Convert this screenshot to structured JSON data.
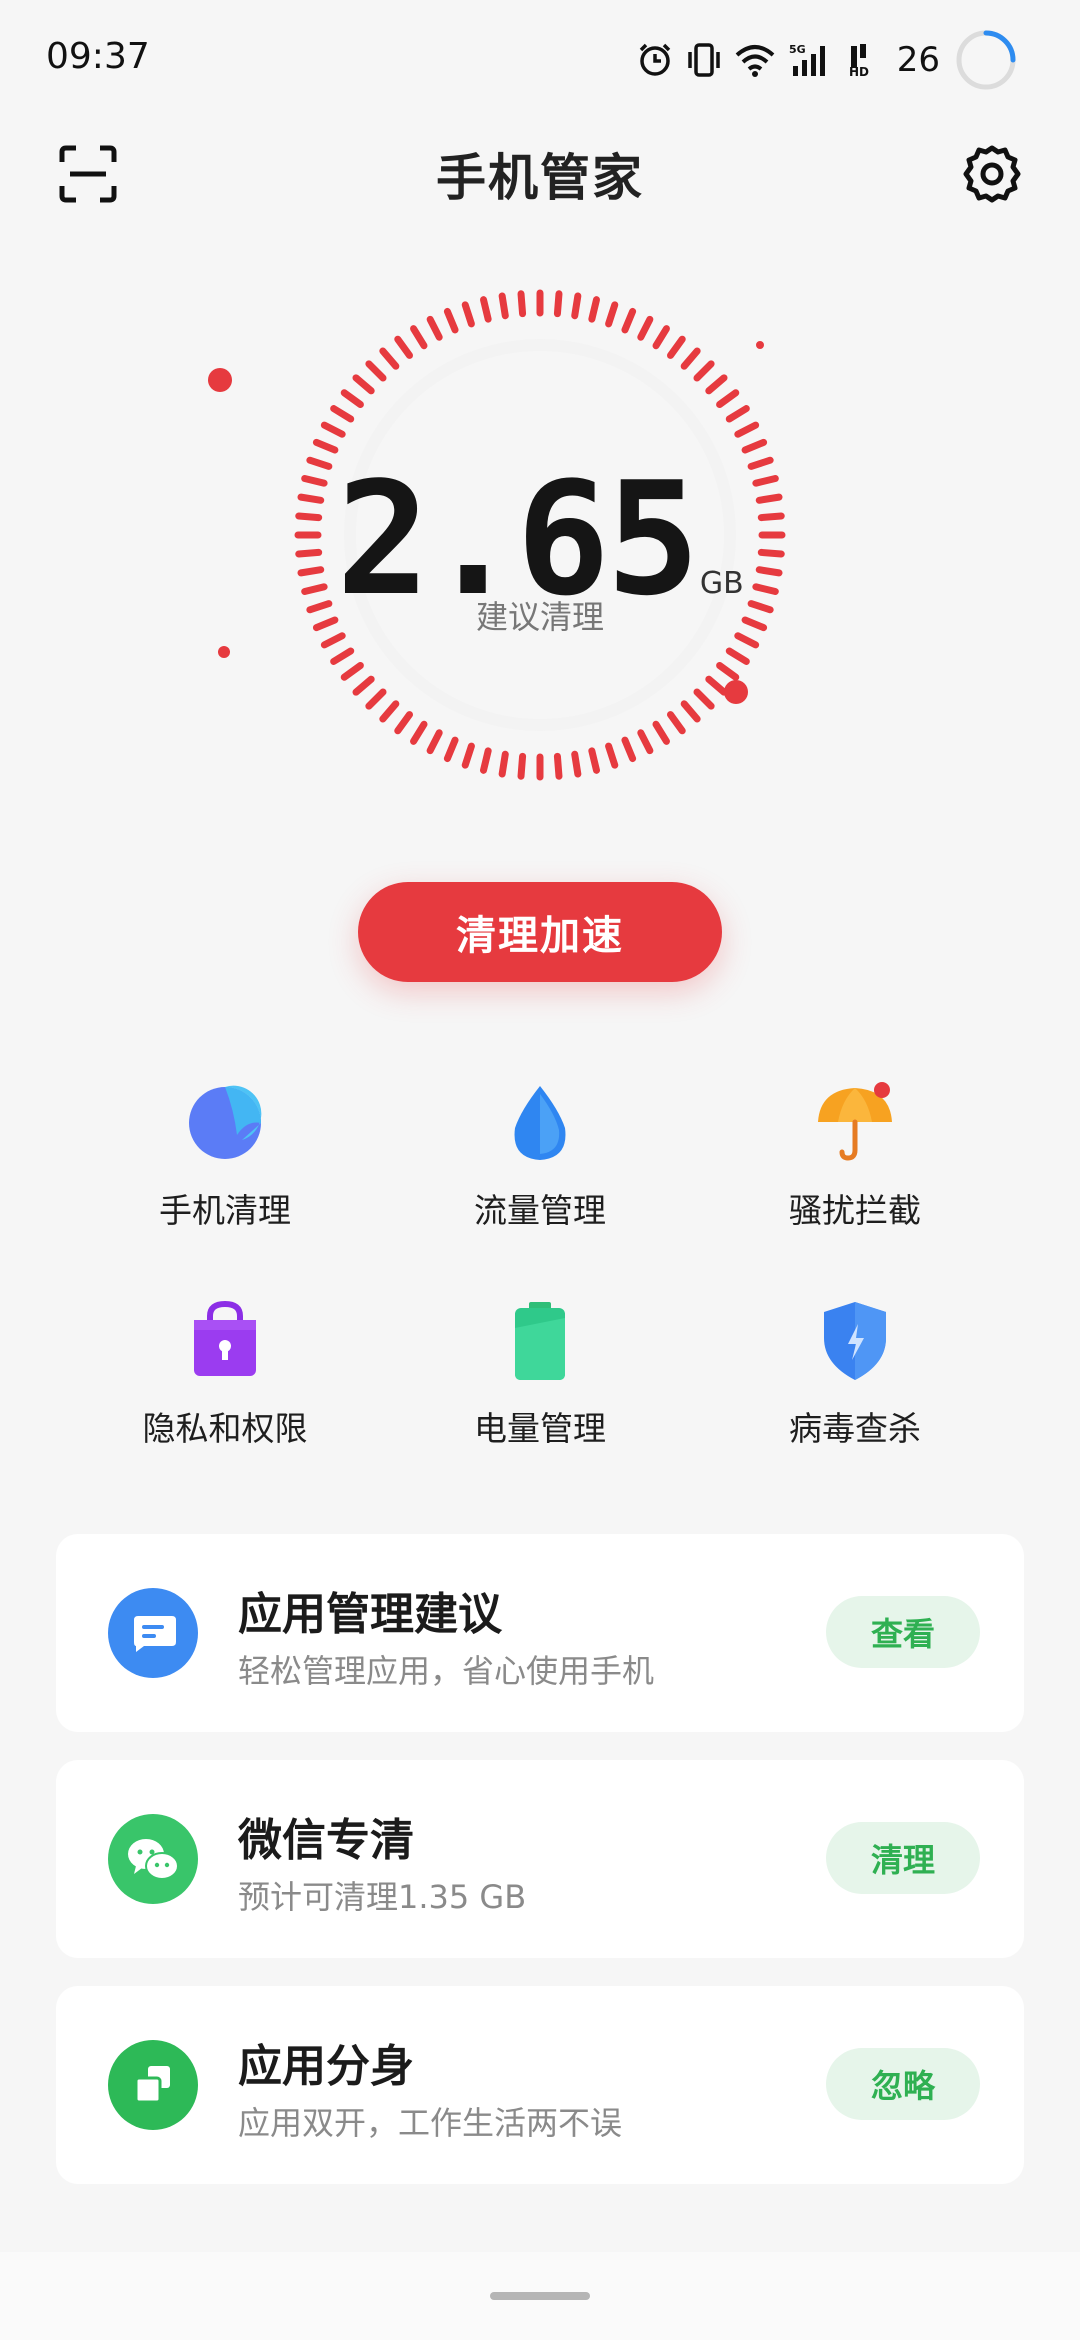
{
  "status_bar": {
    "time": "09:37",
    "battery_level": "26",
    "icons": [
      "alarm-icon",
      "vibrate-icon",
      "wifi-icon",
      "5g-signal-icon",
      "hd-icon",
      "battery-ring-icon"
    ]
  },
  "title_bar": {
    "title": "手机管家",
    "left_icon": "scan-icon",
    "right_icon": "gear-icon"
  },
  "gauge": {
    "value": "2.65",
    "unit": "GB",
    "label": "建议清理",
    "accent_color": "#e63a3f"
  },
  "primary_button": {
    "label": "清理加速",
    "color": "#e63a3f"
  },
  "features": [
    {
      "label": "手机清理",
      "icon": "phone-clean-icon"
    },
    {
      "label": "流量管理",
      "icon": "data-drop-icon"
    },
    {
      "label": "骚扰拦截",
      "icon": "umbrella-icon"
    },
    {
      "label": "隐私和权限",
      "icon": "privacy-lock-bag-icon"
    },
    {
      "label": "电量管理",
      "icon": "battery-icon"
    },
    {
      "label": "病毒查杀",
      "icon": "shield-icon"
    }
  ],
  "cards": [
    {
      "title": "应用管理建议",
      "subtitle": "轻松管理应用，省心使用手机",
      "button": "查看",
      "icon": "chat-message-icon",
      "icon_color": "#3d8bf2"
    },
    {
      "title": "微信专清",
      "subtitle": "预计可清理1.35 GB",
      "button": "清理",
      "icon": "wechat-icon",
      "icon_color": "#39c56a"
    },
    {
      "title": "应用分身",
      "subtitle": "应用双开，工作生活两不误",
      "button": "忽略",
      "icon": "app-clone-icon",
      "icon_color": "#2db957"
    }
  ],
  "colors": {
    "card_button_bg": "#e6f5ea",
    "card_button_text": "#2fb052"
  }
}
